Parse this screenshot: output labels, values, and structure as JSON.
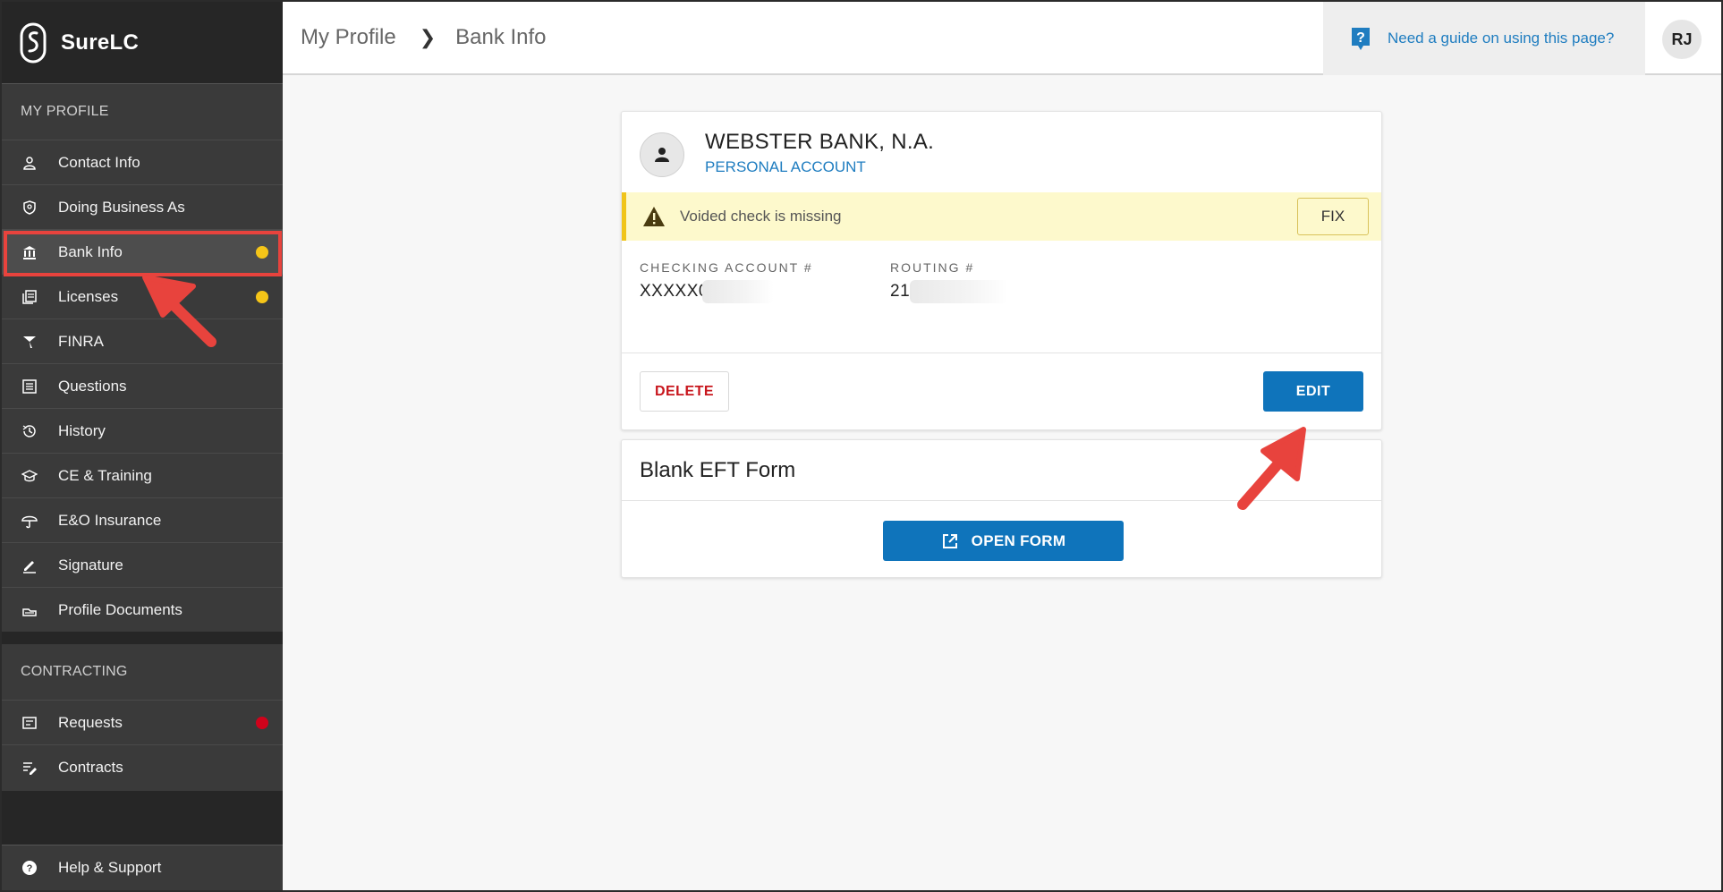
{
  "app": {
    "name": "SureLC"
  },
  "sidebar": {
    "sections": [
      {
        "title": "MY PROFILE",
        "items": [
          {
            "label": "Contact Info",
            "icon": "person-icon"
          },
          {
            "label": "Doing Business As",
            "icon": "badge-icon"
          },
          {
            "label": "Bank Info",
            "icon": "bank-icon",
            "active": true,
            "status": "warning"
          },
          {
            "label": "Licenses",
            "icon": "license-icon",
            "status": "warning"
          },
          {
            "label": "FINRA",
            "icon": "finra-icon"
          },
          {
            "label": "Questions",
            "icon": "list-icon"
          },
          {
            "label": "History",
            "icon": "history-icon"
          },
          {
            "label": "CE & Training",
            "icon": "graduation-cap-icon"
          },
          {
            "label": "E&O Insurance",
            "icon": "umbrella-icon"
          },
          {
            "label": "Signature",
            "icon": "pen-icon"
          },
          {
            "label": "Profile Documents",
            "icon": "document-icon"
          }
        ]
      },
      {
        "title": "CONTRACTING",
        "items": [
          {
            "label": "Requests",
            "icon": "requests-icon",
            "status": "error"
          },
          {
            "label": "Contracts",
            "icon": "contracts-icon"
          }
        ]
      }
    ],
    "help": {
      "label": "Help & Support",
      "icon": "help-icon"
    }
  },
  "header": {
    "breadcrumb": [
      "My Profile",
      "Bank Info"
    ],
    "guide_link": "Need a guide on using this page?",
    "avatar_initials": "RJ"
  },
  "bank_card": {
    "bank_name": "WEBSTER BANK, N.A.",
    "account_type": "PERSONAL ACCOUNT",
    "warning": "Voided check is missing",
    "fix_label": "FIX",
    "checking_label": "CHECKING ACCOUNT #",
    "checking_value": "XXXXX0",
    "routing_label": "ROUTING #",
    "routing_value": "21",
    "delete_label": "DELETE",
    "edit_label": "EDIT"
  },
  "eft_card": {
    "title": "Blank EFT Form",
    "open_label": "OPEN FORM"
  },
  "colors": {
    "accent": "#0f74bb",
    "link": "#1f7dc0",
    "warning_dot": "#f5c518",
    "error_dot": "#d0021b",
    "annotation": "#e8433d"
  }
}
